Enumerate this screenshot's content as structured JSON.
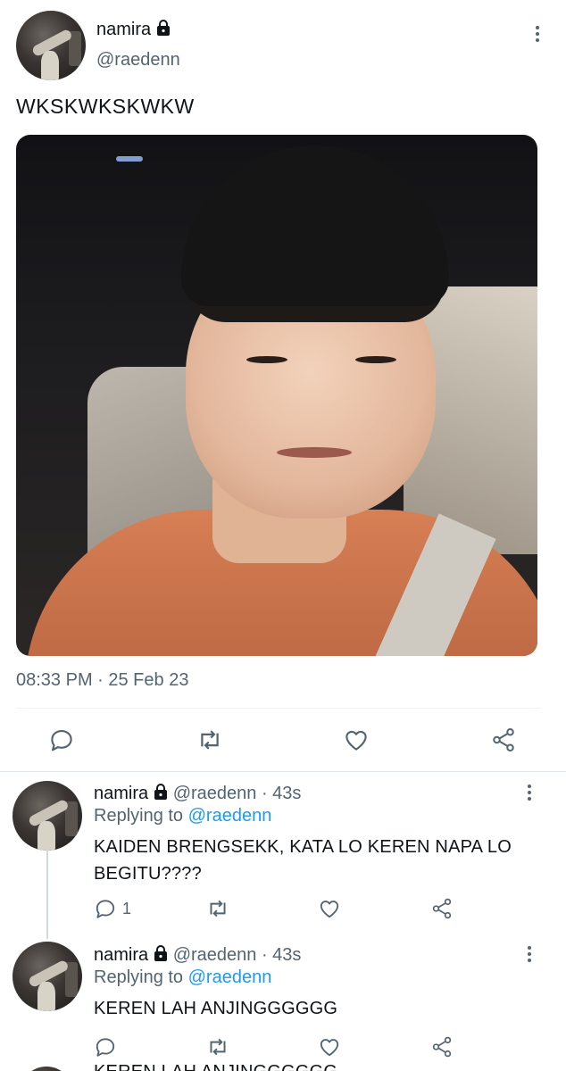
{
  "main_tweet": {
    "display_name": "namira",
    "handle": "@raedenn",
    "text": "WKSKWKSKWKW",
    "timestamp": "08:33 PM · 25 Feb 23",
    "actions": [
      "reply-icon",
      "retweet-icon",
      "like-icon",
      "share-icon"
    ]
  },
  "replies": [
    {
      "display_name": "namira",
      "handle": "@raedenn",
      "age": "· 43s",
      "replying_label": "Replying to",
      "replying_to": "@raedenn",
      "text_line1": "KAIDEN BRENGSEKK, KATA LO KEREN NAPA LO",
      "text_line2": "BEGITU????",
      "reply_count": "1"
    },
    {
      "display_name": "namira",
      "handle": "@raedenn",
      "age": "· 43s",
      "replying_label": "Replying to",
      "replying_to": "@raedenn",
      "text_line1": "KEREN LAH ANJINGGGGGG"
    }
  ],
  "cut_off_text": "KEREN LAH ANJINGGGGGG",
  "colors": {
    "text": "#0f1419",
    "secondary": "#536471",
    "accent": "#1d9bf0"
  }
}
